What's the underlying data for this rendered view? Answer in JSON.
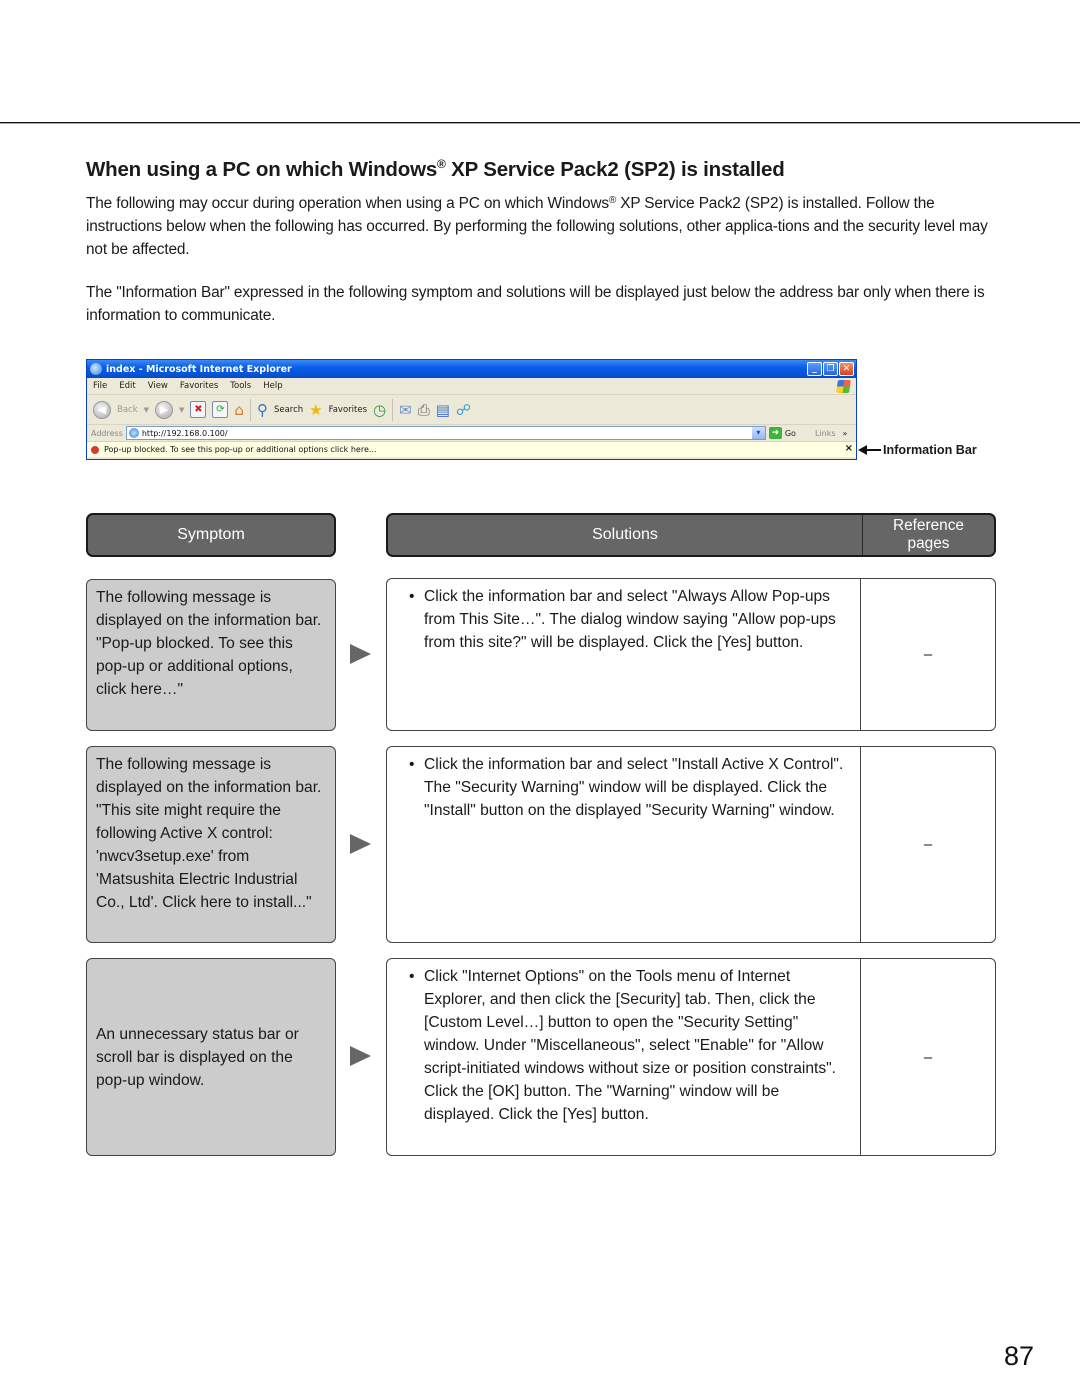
{
  "section": {
    "title_pre": "When using a PC on which Windows",
    "title_reg": "®",
    "title_post": " XP Service Pack2 (SP2) is installed",
    "para1_pre": "The following may occur during operation when using a PC on which Windows",
    "para1_reg": "®",
    "para1_post": " XP Service Pack2 (SP2) is installed. Follow the instructions below when the following has occurred. By performing the following solutions, other applica-tions and the security level may not be affected.",
    "para2": "The \"Information Bar\" expressed in the following symptom and solutions will be displayed just below the address bar only when there is information to communicate."
  },
  "browser_screenshot": {
    "window_title": "index - Microsoft Internet Explorer",
    "window_buttons": [
      "minimize",
      "restore",
      "close"
    ],
    "menu": [
      "File",
      "Edit",
      "View",
      "Favorites",
      "Tools",
      "Help"
    ],
    "toolbar": {
      "back": "Back",
      "search": "Search",
      "favorites": "Favorites"
    },
    "address_label": "Address",
    "address_value": "http://192.168.0.100/",
    "go_label": "Go",
    "links_label": "Links",
    "links_chevron": "»",
    "infobar_text": "Pop-up blocked. To see this pop-up or additional options click here...",
    "infobar_close": "×"
  },
  "callout": {
    "label": "Information Bar"
  },
  "table": {
    "headers": {
      "symptom": "Symptom",
      "solutions": "Solutions",
      "reference": "Reference pages"
    },
    "rows": [
      {
        "symptom": "The following message is displayed on the information bar. \"Pop-up blocked. To see this pop-up or additional options, click here…\"",
        "bullet": "•",
        "solution": "Click the information bar and select \"Always Allow Pop-ups from This Site…\". The dialog window saying \"Allow pop-ups from this site?\" will be displayed. Click the [Yes] button.",
        "reference": "–"
      },
      {
        "symptom": "The following message is displayed on the information bar. \"This site might require the following Active X control: 'nwcv3setup.exe' from 'Matsushita Electric Industrial Co., Ltd'. Click here to install...\"",
        "bullet": "•",
        "solution": "Click the information bar and select \"Install Active X Control\". The \"Security Warning\" window will be displayed. Click the \"Install\" button on the displayed \"Security Warning\" window.",
        "reference": "–"
      },
      {
        "symptom": "An unnecessary status bar or scroll bar is displayed on the pop-up window.",
        "bullet": "•",
        "solution": "Click \"Internet Options\" on the Tools menu of Internet Explorer, and then click the [Security] tab. Then, click the [Custom Level…] button to open the \"Security Setting\" window. Under \"Miscellaneous\", select \"Enable\" for \"Allow script-initiated windows without size or position constraints\". Click the [OK] button. The \"Warning\" window will be displayed. Click the [Yes] button.",
        "reference": "–"
      }
    ]
  },
  "page_number": "87"
}
